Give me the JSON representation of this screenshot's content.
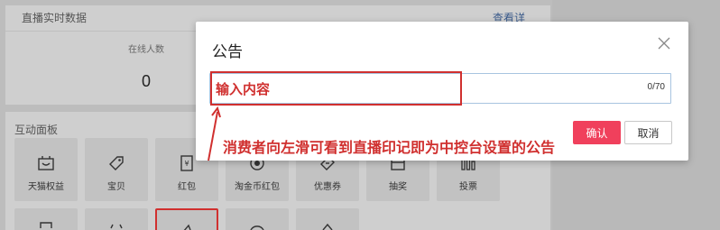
{
  "dashboard": {
    "live_title": "直播实时数据",
    "view_details": "查看详",
    "online_label": "在线人数",
    "online_value": "0",
    "interact_title": "互动面板",
    "tiles": [
      {
        "label": "天猫权益",
        "icon": "tmall-gift-icon"
      },
      {
        "label": "宝贝",
        "icon": "tag-icon"
      },
      {
        "label": "红包",
        "icon": "red-packet-icon"
      },
      {
        "label": "淘金币红包",
        "icon": "coin-icon"
      },
      {
        "label": "优惠券",
        "icon": "coupon-icon"
      },
      {
        "label": "抽奖",
        "icon": "lottery-box-icon"
      },
      {
        "label": "投票",
        "icon": "vote-bars-icon"
      }
    ]
  },
  "modal": {
    "title": "公告",
    "input_value": "输入内容",
    "counter": "0/70",
    "confirm_label": "确认",
    "cancel_label": "取消"
  },
  "annotation": {
    "text": "消费者向左滑可看到直播印记即为中控台设置的公告",
    "color": "#d0302f"
  },
  "colors": {
    "accent": "#f0405c",
    "highlight": "#d0302f",
    "input_border": "#a8c4e0"
  }
}
